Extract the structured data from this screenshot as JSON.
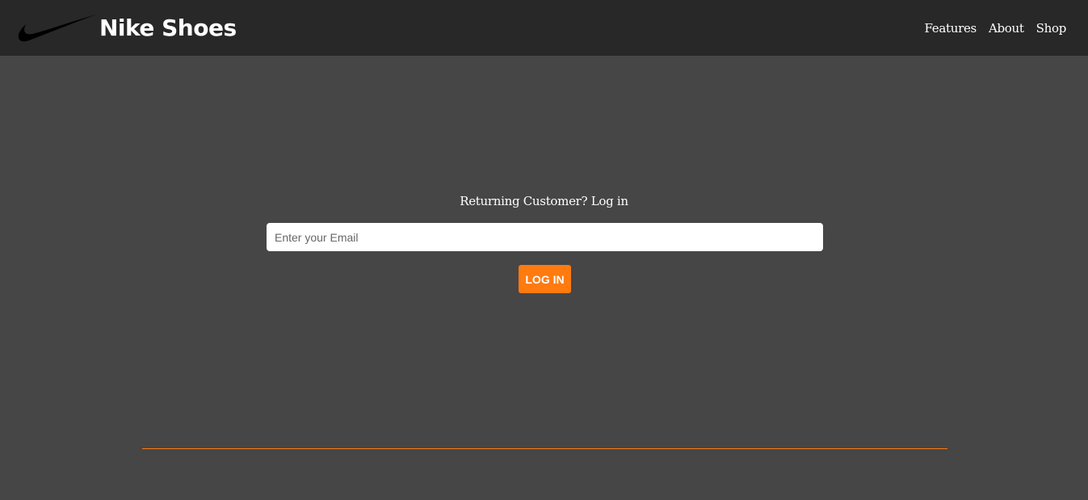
{
  "header": {
    "brand": "Nike Shoes",
    "logo_icon": "swoosh-logo-icon",
    "nav": [
      "Features",
      "About",
      "Shop"
    ]
  },
  "login": {
    "title": "Returning Customer? Log in",
    "email_placeholder": "Enter your Email",
    "email_value": "",
    "button_label": "LOG IN"
  },
  "colors": {
    "header_bg": "#282828",
    "page_bg": "#464646",
    "accent": "#ff7a0f",
    "text": "#ffffff"
  }
}
